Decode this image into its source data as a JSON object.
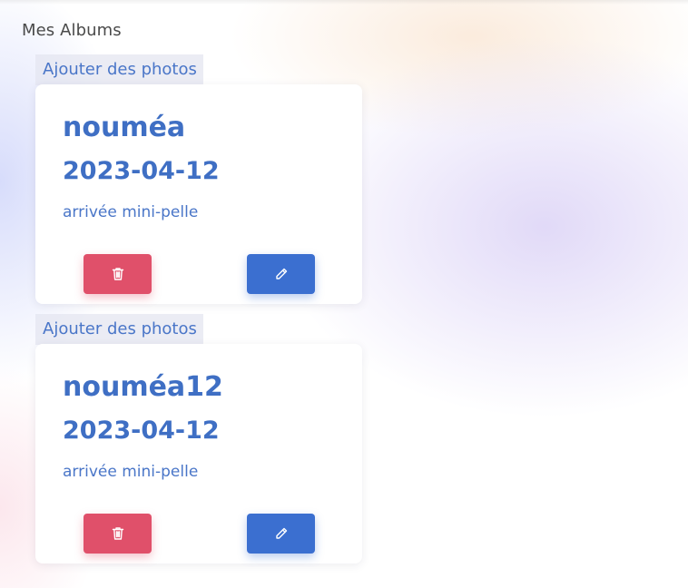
{
  "page": {
    "title": "Mes Albums"
  },
  "colors": {
    "accent": "#3f6fc4",
    "delete": "#e0506a",
    "edit": "#3b6fd0"
  },
  "albums": [
    {
      "add_photos_label": "Ajouter des photos",
      "name": "nouméa",
      "date": "2023-04-12",
      "description": "arrivée mini-pelle",
      "delete_icon": "trash-icon",
      "edit_icon": "pencil-icon"
    },
    {
      "add_photos_label": "Ajouter des photos",
      "name": "nouméa12",
      "date": "2023-04-12",
      "description": "arrivée mini-pelle",
      "delete_icon": "trash-icon",
      "edit_icon": "pencil-icon"
    }
  ]
}
